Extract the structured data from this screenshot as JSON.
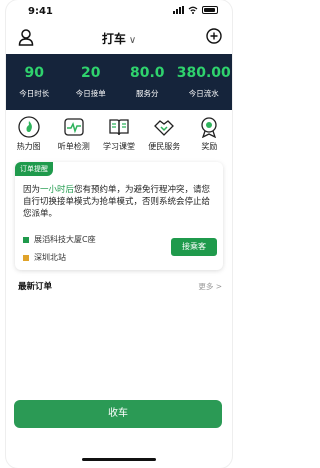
{
  "status_bar": {
    "time": "9:41"
  },
  "nav": {
    "title": "打车",
    "dropdown_glyph": "∨"
  },
  "stats": [
    {
      "value": "90",
      "label": "今日时长"
    },
    {
      "value": "20",
      "label": "今日接单"
    },
    {
      "value": "80.0",
      "label": "服务分"
    },
    {
      "value": "380.00",
      "label": "今日流水"
    }
  ],
  "shortcuts": [
    {
      "label": "热力图",
      "icon": "heatmap-icon"
    },
    {
      "label": "听单检测",
      "icon": "pulse-icon"
    },
    {
      "label": "学习课堂",
      "icon": "book-icon"
    },
    {
      "label": "便民服务",
      "icon": "handshake-icon"
    },
    {
      "label": "奖励",
      "icon": "medal-icon"
    }
  ],
  "notice": {
    "tag": "订单提醒",
    "text_before": "因为",
    "text_highlight_1": "一小时后",
    "text_middle": "您有预约单，为避免行程冲突，请您自行切换接单模式为抢单模式，否则系统会停止给您派单。",
    "address_from": "展滔科技大厦C座",
    "address_to": "深圳北站",
    "accept_label": "接乘客"
  },
  "latest_orders": {
    "title": "最新订单",
    "more": "更多 >"
  },
  "bottom": {
    "label": "收车"
  },
  "colors": {
    "accent": "#1f9a4c",
    "highlight": "#2fd26d",
    "dark_panel": "#15243b"
  }
}
